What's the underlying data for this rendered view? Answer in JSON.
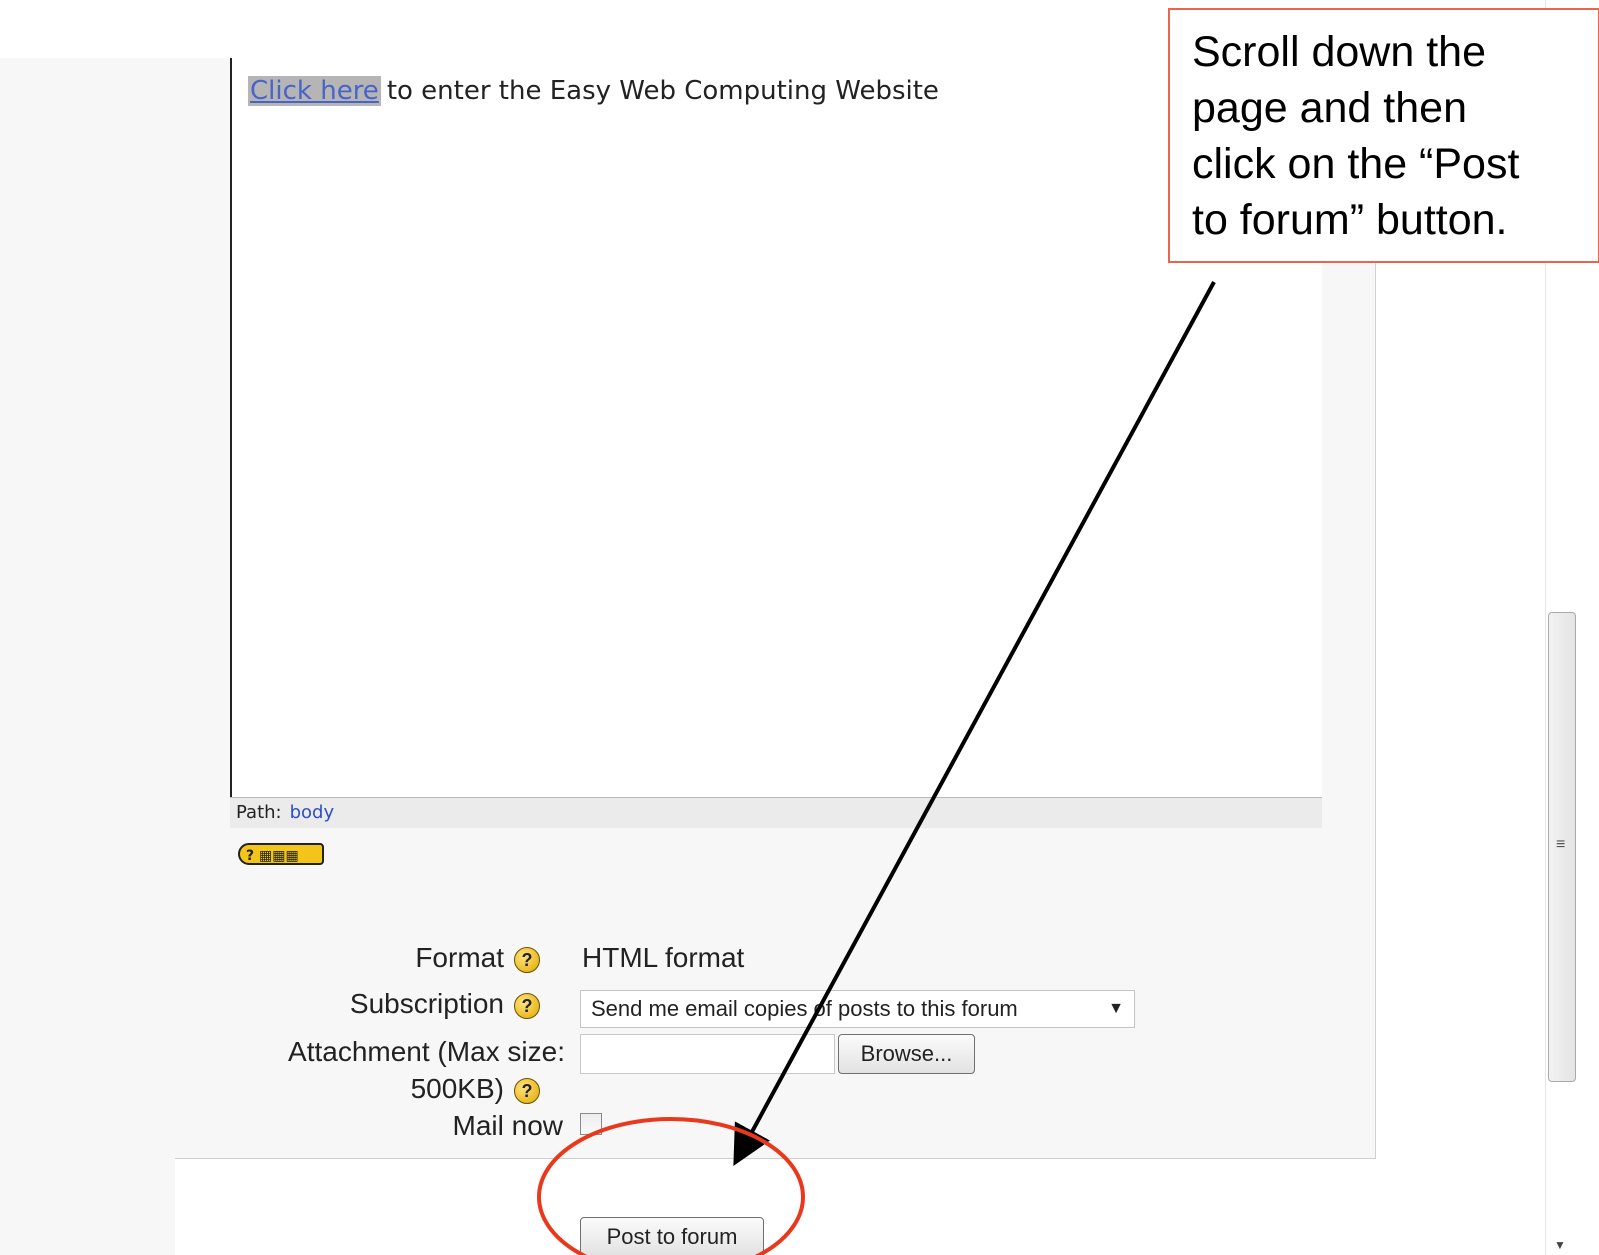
{
  "editor": {
    "link_text": "Click here",
    "rest_text": "to enter the Easy Web Computing Website",
    "path_label": "Path:",
    "path_value": "body"
  },
  "form": {
    "format": {
      "label": "Format",
      "value": "HTML format"
    },
    "subscription": {
      "label": "Subscription",
      "selected": "Send me email copies of posts to this forum"
    },
    "attachment": {
      "label_line1": "Attachment (Max size:",
      "label_line2": "500KB)",
      "browse_label": "Browse..."
    },
    "mail_now": {
      "label": "Mail now",
      "checked": false
    },
    "submit_label": "Post to forum",
    "help_glyph": "?"
  },
  "icons": {
    "help": "help-circle-icon",
    "keyboard": "keyboard-help-icon",
    "select_caret": "chevron-down-icon"
  },
  "callout": {
    "text_lines": [
      "Scroll down the",
      "page and then",
      "click on the “Post",
      "to forum” button."
    ]
  },
  "colors": {
    "callout_border": "#e9654c",
    "highlight_circle": "#e9381b",
    "arrow": "#000000",
    "link": "#4a63c8"
  }
}
